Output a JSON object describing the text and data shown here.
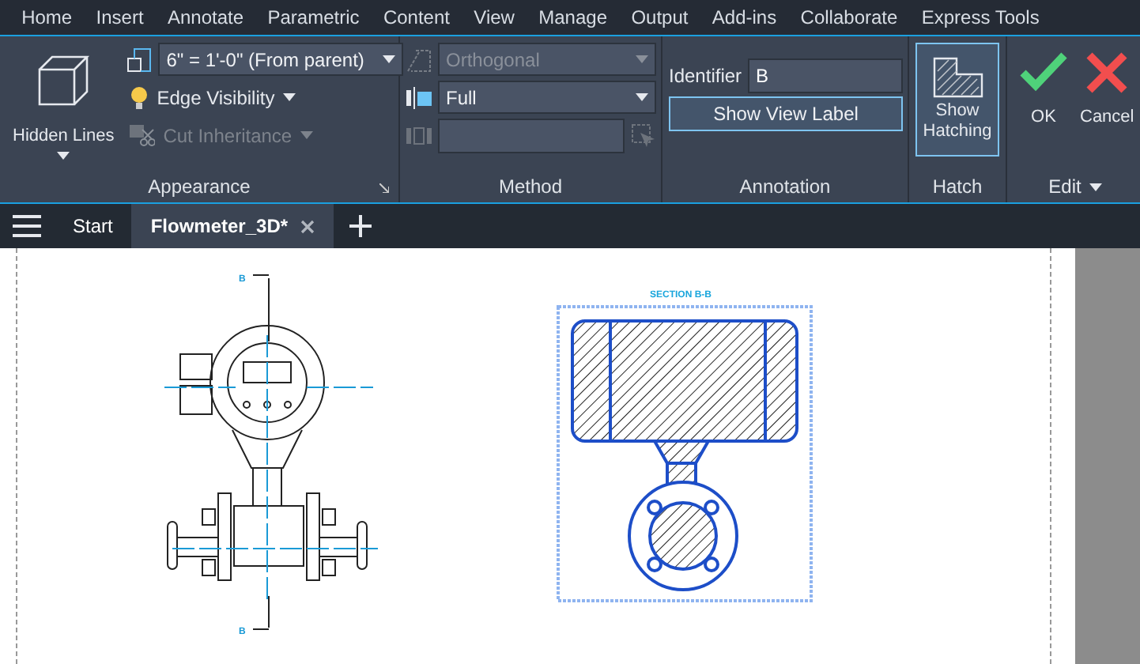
{
  "menu": [
    {
      "label": "Home",
      "selected": false
    },
    {
      "label": "Insert",
      "selected": false
    },
    {
      "label": "Annotate",
      "selected": false
    },
    {
      "label": "Parametric",
      "selected": false
    },
    {
      "label": "Content",
      "selected": false
    },
    {
      "label": "View",
      "selected": false
    },
    {
      "label": "Manage",
      "selected": false
    },
    {
      "label": "Output",
      "selected": false
    },
    {
      "label": "Add-ins",
      "selected": false
    },
    {
      "label": "Collaborate",
      "selected": false
    },
    {
      "label": "Express Tools",
      "selected": false
    }
  ],
  "appearance": {
    "title": "Appearance",
    "style_button": "Hidden Lines",
    "scale": "6\" = 1'-0\" (From parent)",
    "edge_visibility": "Edge Visibility",
    "cut_inheritance": {
      "label": "Cut Inheritance",
      "disabled": true
    }
  },
  "method": {
    "title": "Method",
    "projection": {
      "value": "Orthogonal",
      "disabled": true
    },
    "section_type": {
      "value": "Full",
      "disabled": false
    },
    "depth": {
      "disabled": true
    }
  },
  "annotation": {
    "title": "Annotation",
    "identifier_label": "Identifier",
    "identifier": "B",
    "show_view_label": {
      "label": "Show View Label",
      "on": true
    }
  },
  "hatch": {
    "title": "Hatch",
    "show_hatching": {
      "label": "Show Hatching",
      "on": true
    }
  },
  "edit": {
    "title": "Edit",
    "ok": "OK",
    "cancel": "Cancel"
  },
  "doc_tabs": [
    {
      "label": "Start",
      "selected": false,
      "closable": false
    },
    {
      "label": "Flowmeter_3D*",
      "selected": true,
      "closable": true
    }
  ],
  "drawing": {
    "marker_top": "B",
    "marker_bottom": "B",
    "section_title": "SECTION B-B"
  }
}
